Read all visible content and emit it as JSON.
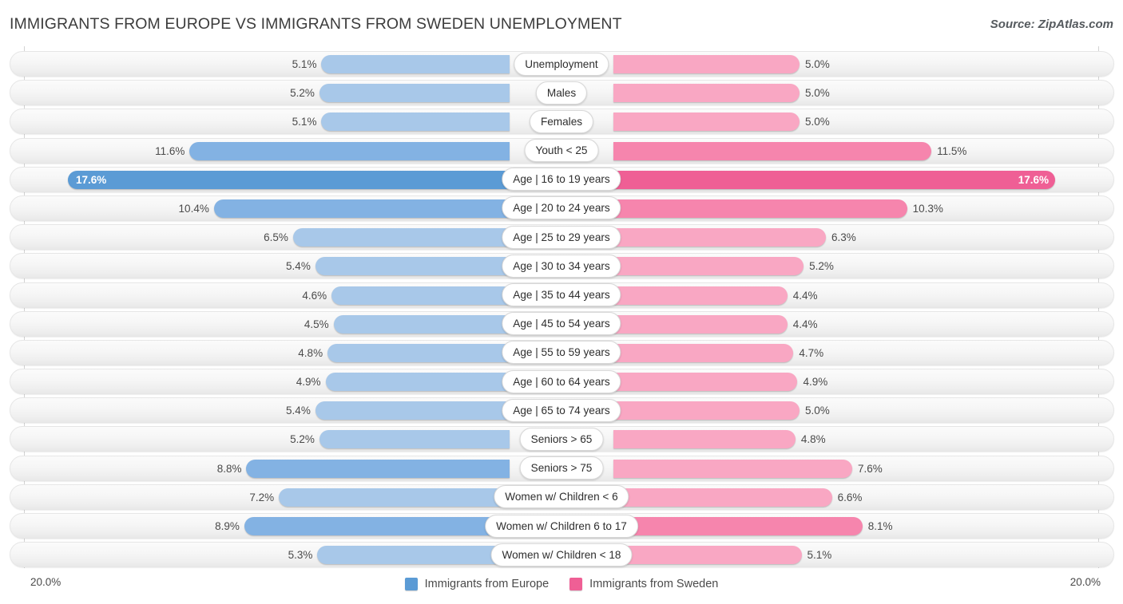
{
  "header": {
    "title": "IMMIGRANTS FROM EUROPE VS IMMIGRANTS FROM SWEDEN UNEMPLOYMENT",
    "source": "Source: ZipAtlas.com"
  },
  "axis": {
    "left_label": "20.0%",
    "right_label": "20.0%",
    "max_percent": 20.0
  },
  "legend": {
    "items": [
      {
        "label": "Immigrants from Europe",
        "color": "#5b9bd5",
        "icon": "legend-swatch-blue"
      },
      {
        "label": "Immigrants from Sweden",
        "color": "#ef5f95",
        "icon": "legend-swatch-pink"
      }
    ]
  },
  "colors": {
    "blue_light": "#a8c8e9",
    "blue_mid": "#83b2e3",
    "blue_dark": "#5b9bd5",
    "pink_light": "#f9a7c3",
    "pink_mid": "#f685ad",
    "pink_dark": "#ef5f95",
    "track": "#f4f4f4",
    "gridline": "#d3d3d3"
  },
  "chart_data": {
    "type": "bar",
    "orientation": "horizontal-diverging",
    "title": "IMMIGRANTS FROM EUROPE VS IMMIGRANTS FROM SWEDEN UNEMPLOYMENT",
    "xlabel": "",
    "ylabel": "",
    "xlim": [
      20.0,
      20.0
    ],
    "grid": true,
    "legend_position": "bottom-center",
    "unit": "%",
    "categories": [
      "Unemployment",
      "Males",
      "Females",
      "Youth < 25",
      "Age | 16 to 19 years",
      "Age | 20 to 24 years",
      "Age | 25 to 29 years",
      "Age | 30 to 34 years",
      "Age | 35 to 44 years",
      "Age | 45 to 54 years",
      "Age | 55 to 59 years",
      "Age | 60 to 64 years",
      "Age | 65 to 74 years",
      "Seniors > 65",
      "Seniors > 75",
      "Women w/ Children < 6",
      "Women w/ Children 6 to 17",
      "Women w/ Children < 18"
    ],
    "series": [
      {
        "name": "Immigrants from Europe",
        "values": [
          5.1,
          5.2,
          5.1,
          11.6,
          17.6,
          10.4,
          6.5,
          5.4,
          4.6,
          4.5,
          4.8,
          4.9,
          5.4,
          5.2,
          8.8,
          7.2,
          8.9,
          5.3
        ],
        "labels": [
          "5.1%",
          "5.2%",
          "5.1%",
          "11.6%",
          "17.6%",
          "10.4%",
          "6.5%",
          "5.4%",
          "4.6%",
          "4.5%",
          "4.8%",
          "4.9%",
          "5.4%",
          "5.2%",
          "8.8%",
          "7.2%",
          "8.9%",
          "5.3%"
        ]
      },
      {
        "name": "Immigrants from Sweden",
        "values": [
          5.0,
          5.0,
          5.0,
          11.5,
          17.6,
          10.3,
          6.3,
          5.2,
          4.4,
          4.4,
          4.7,
          4.9,
          5.0,
          4.8,
          7.6,
          6.6,
          8.1,
          5.1
        ],
        "labels": [
          "5.0%",
          "5.0%",
          "5.0%",
          "11.5%",
          "17.6%",
          "10.3%",
          "6.3%",
          "5.2%",
          "4.4%",
          "4.4%",
          "4.7%",
          "4.9%",
          "5.0%",
          "4.8%",
          "7.6%",
          "6.6%",
          "8.1%",
          "5.1%"
        ]
      }
    ]
  }
}
